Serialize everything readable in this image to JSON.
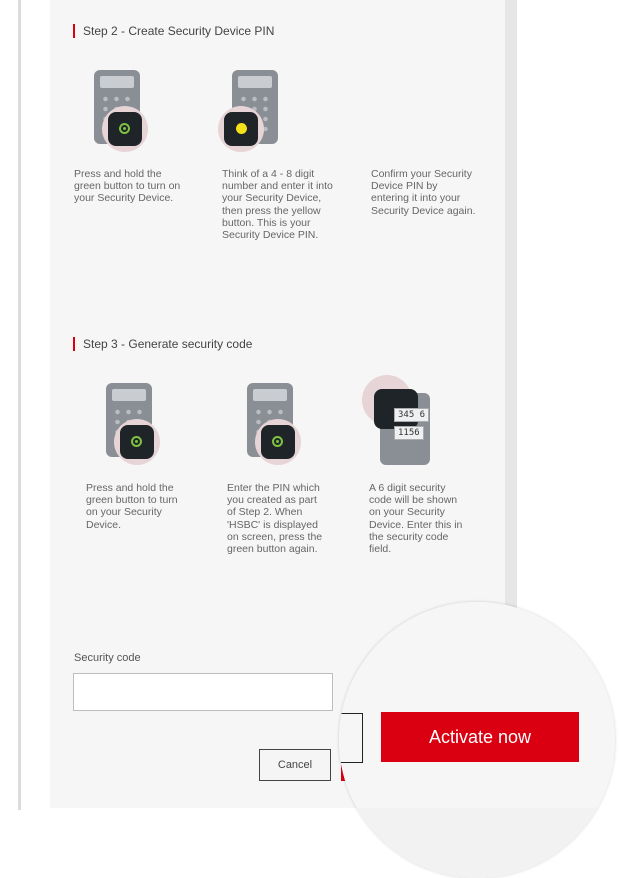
{
  "step2": {
    "heading": "Step 2 - Create Security Device PIN",
    "items": [
      {
        "icon": "security-device-green-button-icon",
        "caption": "Press and hold the green button to turn on your Security Device."
      },
      {
        "icon": "security-device-yellow-button-icon",
        "caption": "Think of a 4 - 8 digit number and enter it into your Security Device, then press the yellow button. This is your Security Device PIN."
      },
      {
        "icon": "",
        "caption": "Confirm your Security Device PIN by entering it into your Security Device again."
      }
    ]
  },
  "step3": {
    "heading": "Step 3 - Generate security code",
    "items": [
      {
        "icon": "security-device-green-button-icon",
        "caption": "Press and hold the green button to turn on your Security Device."
      },
      {
        "icon": "security-device-green-button-icon",
        "caption": "Enter the PIN which you created as part of Step 2. When 'HSBC' is displayed on screen, press the green button again."
      },
      {
        "icon": "security-device-code-screen-icon",
        "caption": "A 6 digit security code will be shown on your Security Device. Enter this in the security code field.",
        "screen_text": [
          "345 6",
          "1156"
        ]
      }
    ]
  },
  "form": {
    "security_code_label": "Security code",
    "security_code_value": "",
    "cancel_label": "Cancel",
    "activate_label": "Activate now"
  },
  "colors": {
    "accent_red": "#db0011",
    "green_button": "#7fc241",
    "yellow_button": "#f5e11b"
  }
}
